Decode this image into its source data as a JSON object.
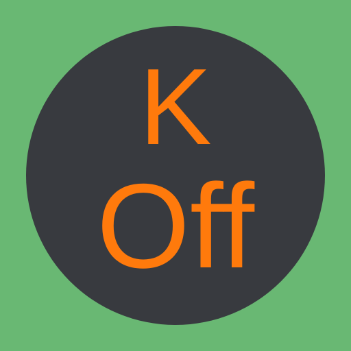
{
  "icon": {
    "line_top": "K",
    "line_bottom": "Off"
  },
  "colors": {
    "background": "#69b873",
    "circle": "#383a3f",
    "text": "#ff7a0c"
  }
}
